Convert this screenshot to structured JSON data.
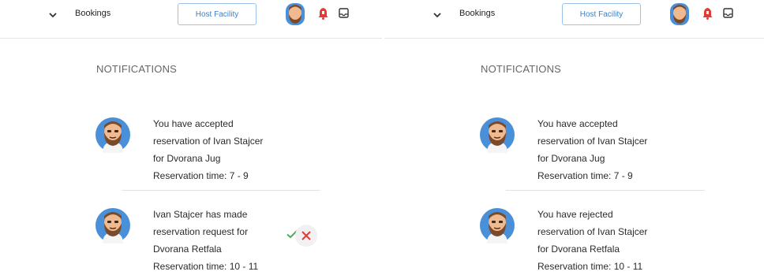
{
  "header": {
    "nav_label": "Bookings",
    "host_button": "Host Facility",
    "icons": [
      "chevron-down-icon",
      "avatar",
      "bell-icon",
      "inbox-icon"
    ],
    "bell_color": "#e53935",
    "button_color": "#3f7fc8"
  },
  "panels": [
    {
      "title": "NOTIFICATIONS",
      "notifications": [
        {
          "lines": [
            "You have accepted",
            "reservation of Ivan Stajcer",
            "for Dvorana Jug",
            "Reservation time: 7 - 9"
          ]
        },
        {
          "lines": [
            "Ivan Stajcer has made",
            "reservation request for",
            "Dvorana Retfala",
            "Reservation time: 10 - 11"
          ],
          "actions": [
            "accept-icon",
            "reject-icon"
          ],
          "accept_color": "#4caf50",
          "reject_color": "#e53935"
        }
      ]
    },
    {
      "title": "NOTIFICATIONS",
      "notifications": [
        {
          "lines": [
            "You have accepted",
            "reservation of Ivan Stajcer",
            "for Dvorana Jug",
            "Reservation time: 7 - 9"
          ]
        },
        {
          "lines": [
            "You have rejected",
            "reservation of Ivan Stajcer",
            "for Dvorana Retfala",
            "Reservation time: 10 - 11"
          ]
        }
      ]
    }
  ]
}
